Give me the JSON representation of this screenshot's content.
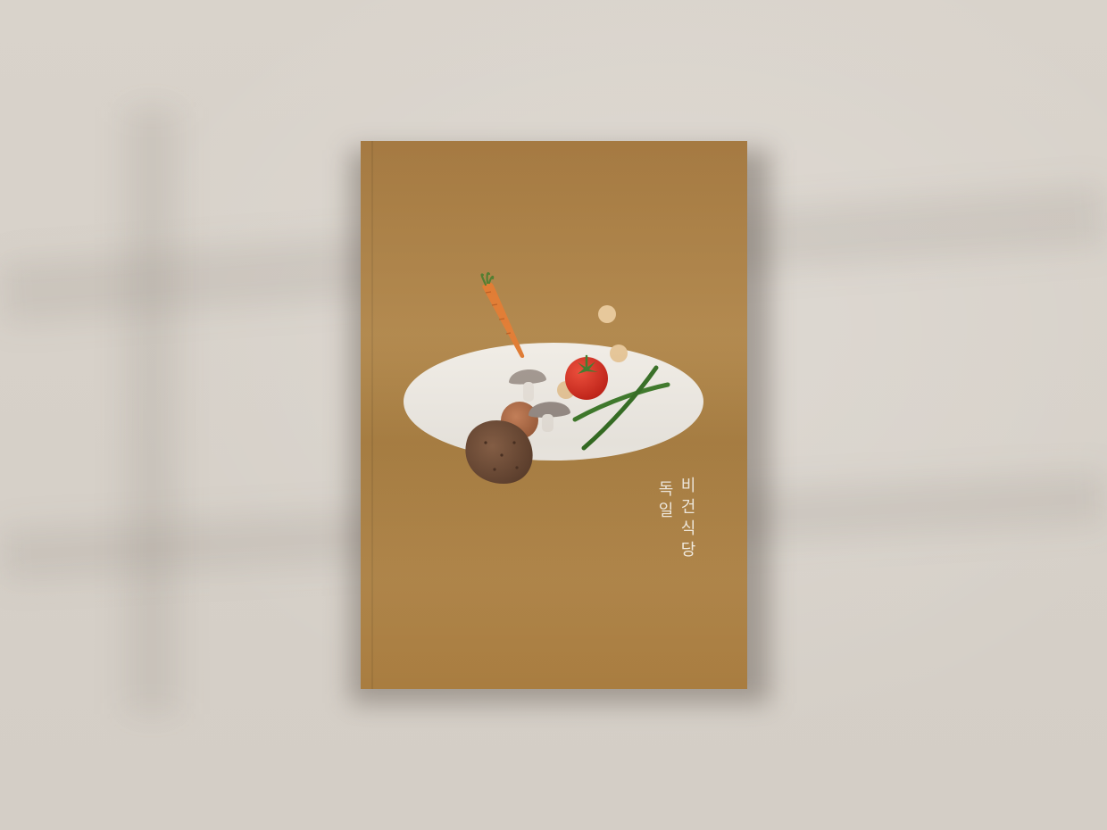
{
  "cover": {
    "title_line_1": [
      "비",
      "건",
      "식",
      "당"
    ],
    "title_line_2": [
      "독",
      "일"
    ]
  },
  "colors": {
    "wall": "#d6d0c8",
    "cover": "#ab7f43",
    "plate": "#f1ede6",
    "title_text": "#f3ece0",
    "carrot": "#e0782d",
    "tomato": "#d62b1e",
    "green_bean": "#3e7a2a",
    "mushroom": "#9e928a",
    "potato": "#6b4a36",
    "chickpea": "#e6c596"
  }
}
